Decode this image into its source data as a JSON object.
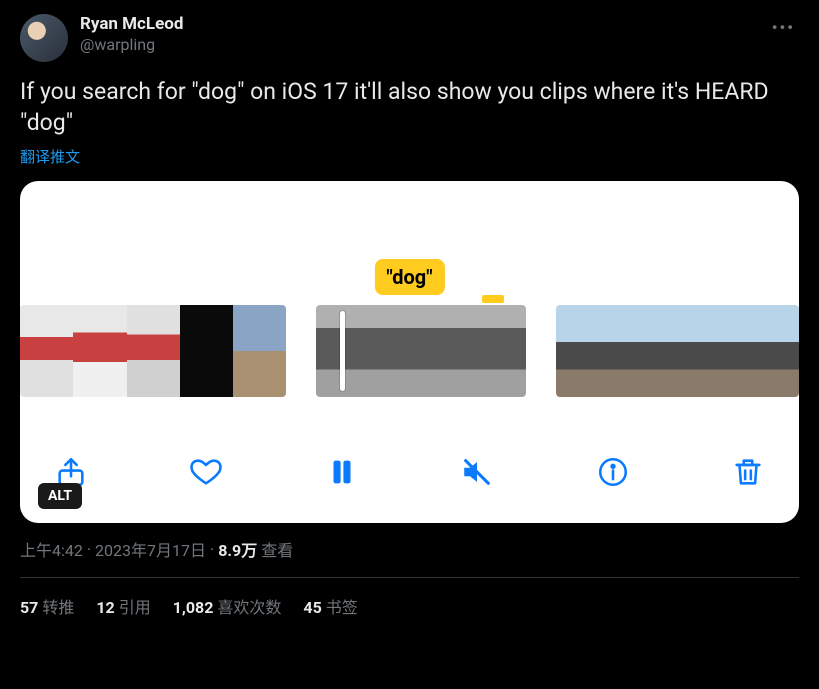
{
  "author": {
    "display_name": "Ryan McLeod",
    "handle": "@warpling"
  },
  "tweet": {
    "text": "If you search for \"dog\" on iOS 17 it'll also show you clips where it's HEARD \"dog\"",
    "translate_label": "翻译推文"
  },
  "media": {
    "caption_chip": "\"dog\"",
    "alt_label": "ALT"
  },
  "meta": {
    "time": "上午4:42",
    "sep": " · ",
    "date": "2023年7月17日",
    "views_count": "8.9万",
    "views_label": " 查看"
  },
  "stats": {
    "retweets_count": "57",
    "retweets_label": "转推",
    "quotes_count": "12",
    "quotes_label": "引用",
    "likes_count": "1,082",
    "likes_label": "喜欢次数",
    "bookmarks_count": "45",
    "bookmarks_label": "书签"
  }
}
